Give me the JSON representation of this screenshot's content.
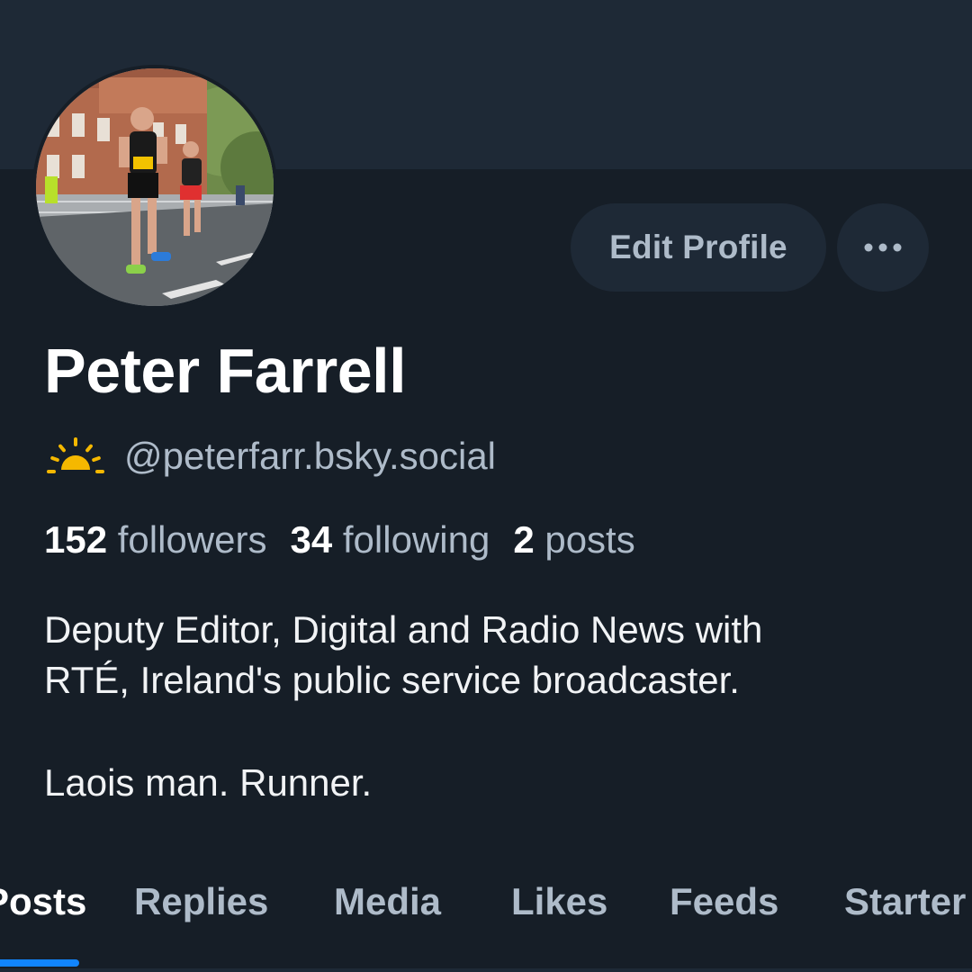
{
  "profile": {
    "display_name": "Peter Farrell",
    "handle": "@peterfarr.bsky.social",
    "handle_icon": "sunrise-icon",
    "avatar_alt": "runner-photo",
    "edit_label": "Edit Profile",
    "more_icon": "more-horizontal-icon"
  },
  "stats": {
    "followers_count": "152",
    "followers_label": "followers",
    "following_count": "34",
    "following_label": "following",
    "posts_count": "2",
    "posts_label": "posts"
  },
  "bio": {
    "line1": "Deputy Editor, Digital and Radio News with",
    "line2": "RTÉ, Ireland's public service broadcaster.",
    "line3": "Laois man. Runner."
  },
  "tabs": [
    {
      "label": "Posts",
      "active": true
    },
    {
      "label": "Replies",
      "active": false
    },
    {
      "label": "Media",
      "active": false
    },
    {
      "label": "Likes",
      "active": false
    },
    {
      "label": "Feeds",
      "active": false
    },
    {
      "label": "Starter Packs",
      "active": false
    }
  ],
  "colors": {
    "background": "#161e27",
    "banner": "#1e2936",
    "accent": "#1185fe",
    "muted_text": "#aebbc9",
    "sun": "#f5b800"
  }
}
